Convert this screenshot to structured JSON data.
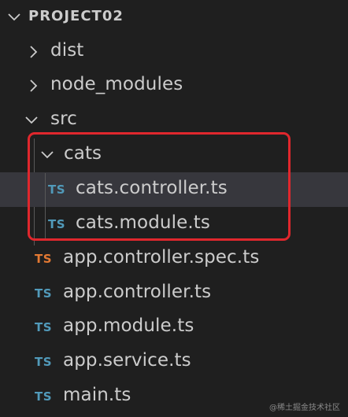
{
  "explorer": {
    "project_title": "PROJECT02",
    "folders": {
      "dist": "dist",
      "node_modules": "node_modules",
      "src": "src",
      "cats": "cats"
    },
    "cats_files": [
      {
        "name": "cats.controller.ts",
        "icon": "TS"
      },
      {
        "name": "cats.module.ts",
        "icon": "TS"
      }
    ],
    "src_files": [
      {
        "name": "app.controller.spec.ts",
        "icon": "TS",
        "icon_color": "#e37933"
      },
      {
        "name": "app.controller.ts",
        "icon": "TS",
        "icon_color": "#519aba"
      },
      {
        "name": "app.module.ts",
        "icon": "TS",
        "icon_color": "#519aba"
      },
      {
        "name": "app.service.ts",
        "icon": "TS",
        "icon_color": "#519aba"
      },
      {
        "name": "main.ts",
        "icon": "TS",
        "icon_color": "#519aba"
      }
    ]
  },
  "colors": {
    "background": "#1f1f1f",
    "selected_row": "#37373d",
    "ts_blue": "#519aba",
    "ts_orange": "#e37933",
    "highlight_red": "#e0272d",
    "text": "#cccccc"
  },
  "watermark": "@稀土掘金技术社区"
}
